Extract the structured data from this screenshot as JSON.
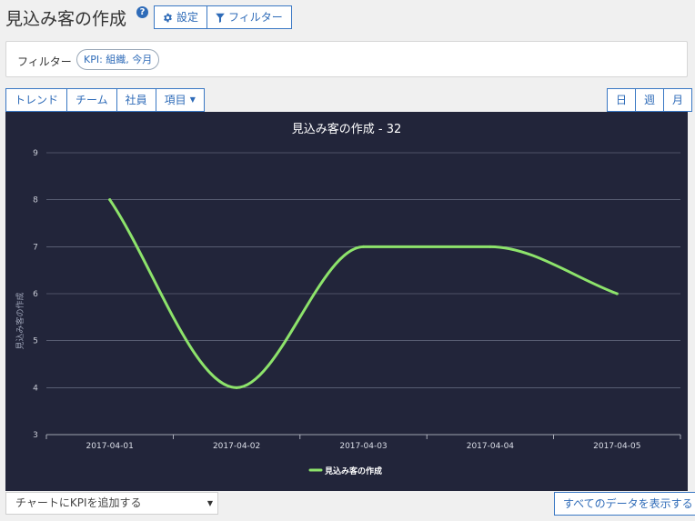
{
  "page": {
    "title": "見込み客の作成",
    "help": "?"
  },
  "toolbar": {
    "settings": "設定",
    "filter": "フィルター"
  },
  "filter_bar": {
    "label": "フィルター",
    "pill": "KPI: 組織, 今月"
  },
  "view_tabs": [
    "トレンド",
    "チーム",
    "社員",
    "項目"
  ],
  "period_tabs": [
    "日",
    "週",
    "月"
  ],
  "bottom": {
    "add_kpi": "チャートにKPIを追加する",
    "show_all": "すべてのデータを表示する"
  },
  "chart_data": {
    "type": "line",
    "title": "見込み客の作成 - 32",
    "ylabel": "見込み客の作成",
    "xlabel": "",
    "ylim": [
      3,
      9
    ],
    "yticks": [
      3,
      4,
      5,
      6,
      7,
      8,
      9
    ],
    "categories": [
      "2017-04-01",
      "2017-04-02",
      "2017-04-03",
      "2017-04-04",
      "2017-04-05"
    ],
    "series": [
      {
        "name": "見込み客の作成",
        "color": "#8de36b",
        "values": [
          8,
          4,
          7,
          7,
          6
        ]
      }
    ],
    "grid": true,
    "legend": "bottom-center",
    "background": "#22253a"
  }
}
